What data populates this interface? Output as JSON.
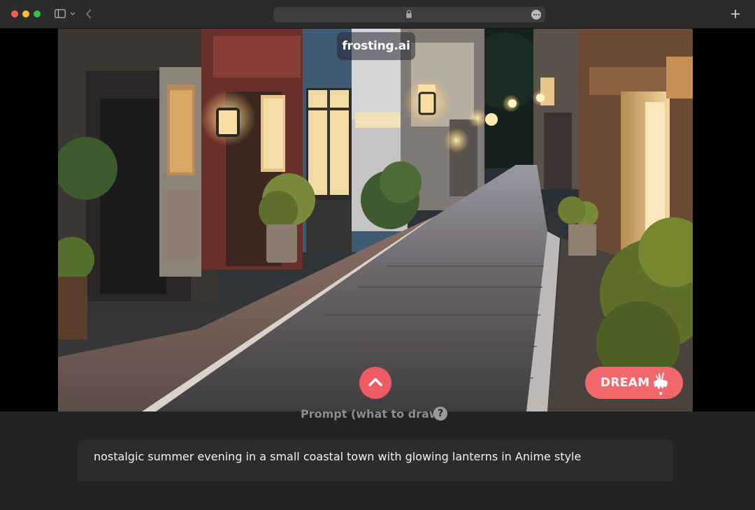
{
  "browser": {
    "icons": [
      "close-window",
      "minimize-window",
      "zoom-window",
      "sidebar-toggle",
      "chevron-down",
      "back-chevron",
      "lock",
      "more",
      "new-tab"
    ],
    "colors": {
      "close": "#ff5f57",
      "minimize": "#febc2e",
      "zoom": "#28c840"
    }
  },
  "app": {
    "brand": "frosting.ai",
    "dream_button": "DREAM",
    "prompt_label": "Prompt (what to draw)",
    "help_glyph": "?",
    "prompt_value": "nostalgic summer evening in a small coastal town with glowing lanterns in Anime style",
    "accent_color": "#f0676c"
  }
}
